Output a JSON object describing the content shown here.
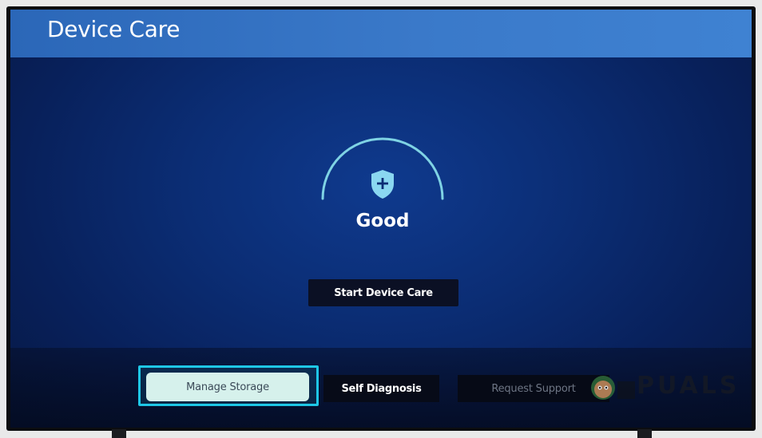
{
  "header": {
    "title": "Device Care"
  },
  "status": {
    "label": "Good",
    "icon": "shield-plus-icon"
  },
  "actions": {
    "start_label": "Start Device Care"
  },
  "menu": {
    "manage_storage": "Manage Storage",
    "self_diagnosis": "Self Diagnosis",
    "request_support": "Request Support"
  },
  "watermark": {
    "text": "PUALS"
  },
  "colors": {
    "accent_focus": "#1ec7e6",
    "header_blue": "#3a79c9",
    "background_blue": "#0b2d74",
    "selected_button": "#d6f1ec"
  }
}
